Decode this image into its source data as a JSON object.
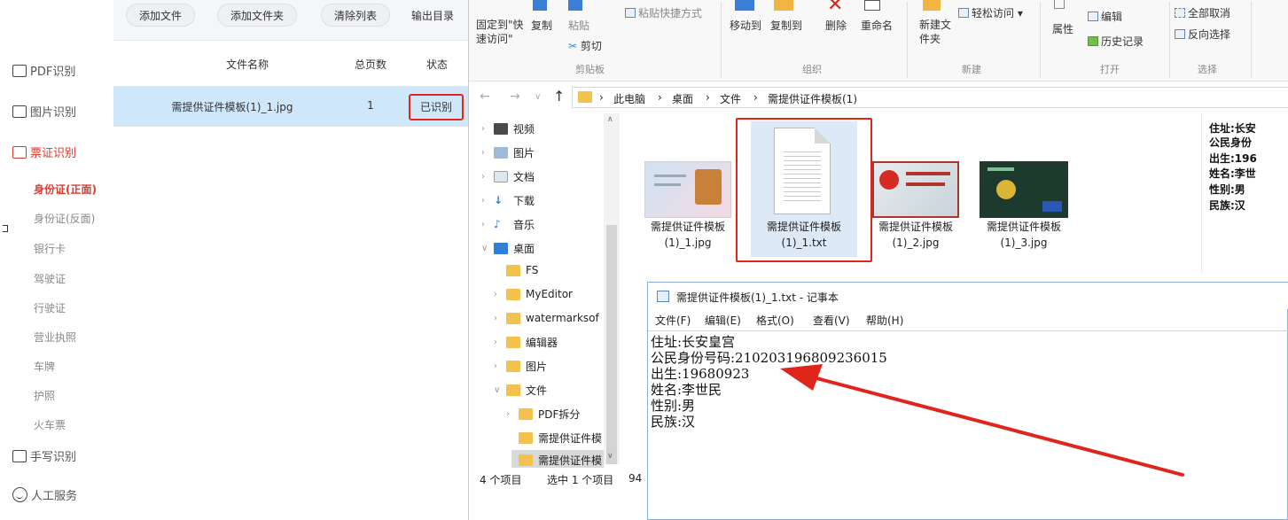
{
  "app": {
    "toolbar": {
      "add_file": "添加文件",
      "add_folder": "添加文件夹",
      "clear_list": "清除列表",
      "output_dir": "输出目录"
    },
    "sidebar": {
      "pdf": "PDF识别",
      "image": "图片识别",
      "ticket": "票证识别",
      "handwriting": "手写识别",
      "service": "人工服务",
      "sub_items": [
        "身份证(正面)",
        "身份证(反面)",
        "银行卡",
        "驾驶证",
        "行驶证",
        "营业执照",
        "车牌",
        "护照",
        "火车票"
      ]
    },
    "table": {
      "headers": {
        "name": "文件名称",
        "pages": "总页数",
        "status": "状态"
      },
      "rows": [
        {
          "name": "需提供证件模板(1)_1.jpg",
          "pages": "1",
          "status": "已识别"
        }
      ]
    }
  },
  "explorer": {
    "ribbon": {
      "pin": "固定到\"快速访问\"",
      "copy": "复制",
      "paste": "粘贴",
      "paste_shortcut": "粘贴快捷方式",
      "cut": "剪切",
      "clipboard": "剪贴板",
      "move_to": "移动到",
      "copy_to": "复制到",
      "delete": "删除",
      "rename": "重命名",
      "organize": "组织",
      "new_folder": "新建文件夹",
      "easy_access": "轻松访问",
      "new_group": "新建",
      "properties": "属性",
      "edit": "编辑",
      "history": "历史记录",
      "open_group": "打开",
      "select_none": "全部取消",
      "invert_select": "反向选择",
      "select_group": "选择"
    },
    "breadcrumbs": [
      "此电脑",
      "桌面",
      "文件",
      "需提供证件模板(1)"
    ],
    "nav": [
      "视频",
      "图片",
      "文档",
      "下载",
      "音乐",
      "桌面",
      "FS",
      "MyEditor",
      "watermarksof",
      "编辑器",
      "图片",
      "文件",
      "PDF拆分",
      "需提供证件模",
      "需提供证件模"
    ],
    "status": {
      "count": "4 个项目",
      "selected": "选中 1 个项目",
      "size": "94"
    },
    "files": [
      {
        "line1": "需提供证件模板",
        "line2": "(1)_1.jpg"
      },
      {
        "line1": "需提供证件模板",
        "line2": "(1)_1.txt"
      },
      {
        "line1": "需提供证件模板",
        "line2": "(1)_2.jpg"
      },
      {
        "line1": "需提供证件模板",
        "line2": "(1)_3.jpg"
      }
    ],
    "preview": [
      "住址:长安",
      "公民身份",
      "出生:196",
      "姓名:李世",
      "性别:男",
      "民族:汉"
    ]
  },
  "notepad": {
    "title": "需提供证件模板(1)_1.txt - 记事本",
    "menu": [
      "文件(F)",
      "编辑(E)",
      "格式(O)",
      "查看(V)",
      "帮助(H)"
    ],
    "lines": [
      "住址:长安皇宫",
      "公民身份号码:210203196809236015",
      "出生:19680923",
      "姓名:李世民",
      "性别:男",
      "民族:汉"
    ]
  },
  "colors": {
    "highlight_red": "#e0251b",
    "accent_red": "#d83a2e",
    "row_select_blue": "#cfe7fb"
  }
}
